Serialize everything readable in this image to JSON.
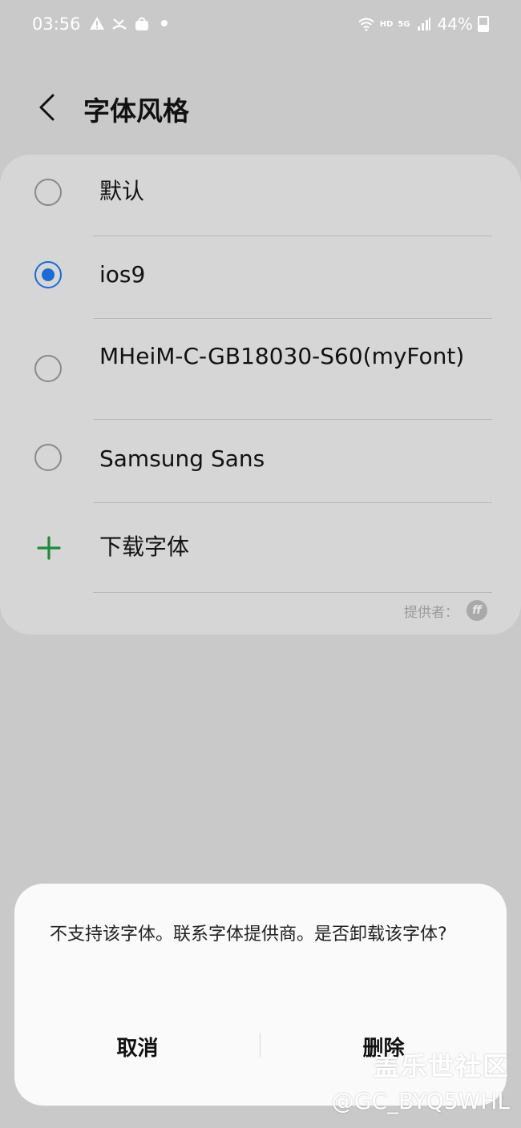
{
  "status_bar": {
    "time": "03:56",
    "left_icons": [
      "warning-icon",
      "missed-call-icon",
      "shopping-bag-icon",
      "dot-icon"
    ],
    "network_hd": "HD",
    "network_5g": "5G",
    "battery": "44%"
  },
  "header": {
    "title": "字体风格",
    "back_icon": "chevron-left-icon"
  },
  "options": [
    {
      "label": "默认",
      "selected": false
    },
    {
      "label": "ios9",
      "selected": true
    },
    {
      "label": "MHeiM-C-GB18030-S60(myFont)",
      "selected": false
    },
    {
      "label": "Samsung Sans",
      "selected": false
    }
  ],
  "download": {
    "label": "下载字体",
    "icon": "plus-icon",
    "color": "#1e8a3c"
  },
  "provider": {
    "label": "提供者：",
    "logo_text": "ff"
  },
  "dialog": {
    "message": "不支持该字体。联系字体提供商。是否卸载该字体?",
    "cancel_label": "取消",
    "delete_label": "删除"
  },
  "watermark": {
    "title": "盖乐世社区",
    "handle": "@GC_BYQ5WHL"
  },
  "colors": {
    "accent": "#1a6bd6",
    "background": "#c9c9c9",
    "card": "#d6d6d6"
  }
}
